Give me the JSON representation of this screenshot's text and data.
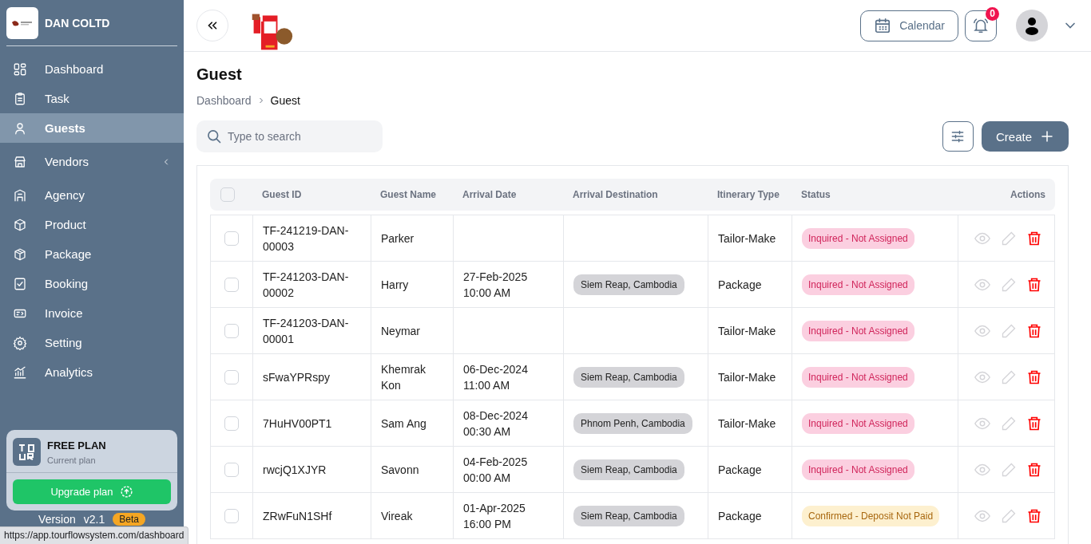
{
  "sidebar": {
    "brand": "DAN COLTD",
    "items": [
      {
        "label": "Dashboard",
        "selected": false
      },
      {
        "label": "Task",
        "selected": false
      },
      {
        "label": "Guests",
        "selected": true
      },
      {
        "label": "Vendors",
        "selected": false,
        "expandable": true
      },
      {
        "label": "Agency",
        "selected": false
      },
      {
        "label": "Product",
        "selected": false
      },
      {
        "label": "Package",
        "selected": false
      },
      {
        "label": "Booking",
        "selected": false
      },
      {
        "label": "Invoice",
        "selected": false
      },
      {
        "label": "Setting",
        "selected": false
      },
      {
        "label": "Analytics",
        "selected": false
      }
    ],
    "plan": {
      "title": "FREE PLAN",
      "subtitle": "Current plan",
      "button": "Upgrade plan"
    },
    "version": {
      "label": "Version",
      "number": "v2.1",
      "badge": "Beta"
    }
  },
  "topbar": {
    "calendar": "Calendar",
    "notifications": "0"
  },
  "page": {
    "title": "Guest",
    "breadcrumb": [
      "Dashboard",
      "Guest"
    ],
    "search_placeholder": "Type to search",
    "create": "Create"
  },
  "table": {
    "all_selected": false,
    "columns": [
      "Guest ID",
      "Guest Name",
      "Arrival Date",
      "Arrival Destination",
      "Itinerary Type",
      "Status",
      "Actions"
    ],
    "rows": [
      {
        "selected": false,
        "guest_id": "TF-241219-DAN-00003",
        "name": "Parker",
        "date": "",
        "time": "",
        "destination": "",
        "itinerary": "Tailor-Make",
        "status": {
          "text": "Inquired - Not Assigned",
          "kind": "inquired"
        }
      },
      {
        "selected": false,
        "guest_id": "TF-241203-DAN-00002",
        "name": "Harry",
        "date": "27-Feb-2025",
        "time": "10:00 AM",
        "destination": "Siem Reap, Cambodia",
        "itinerary": "Package",
        "status": {
          "text": "Inquired - Not Assigned",
          "kind": "inquired"
        }
      },
      {
        "selected": false,
        "guest_id": "TF-241203-DAN-00001",
        "name": "Neymar",
        "date": "",
        "time": "",
        "destination": "",
        "itinerary": "Tailor-Make",
        "status": {
          "text": "Inquired - Not Assigned",
          "kind": "inquired"
        }
      },
      {
        "selected": false,
        "guest_id": "sFwaYPRspy",
        "name": "Khemrak Kon",
        "date": "06-Dec-2024",
        "time": "11:00 AM",
        "destination": "Siem Reap, Cambodia",
        "itinerary": "Tailor-Make",
        "status": {
          "text": "Inquired - Not Assigned",
          "kind": "inquired"
        }
      },
      {
        "selected": false,
        "guest_id": "7HuHV00PT1",
        "name": "Sam Ang",
        "date": "08-Dec-2024",
        "time": "00:30 AM",
        "destination": "Phnom Penh, Cambodia",
        "itinerary": "Tailor-Make",
        "status": {
          "text": "Inquired - Not Assigned",
          "kind": "inquired"
        }
      },
      {
        "selected": false,
        "guest_id": "rwcjQ1XJYR",
        "name": "Savonn",
        "date": "04-Feb-2025",
        "time": "00:00 AM",
        "destination": "Siem Reap, Cambodia",
        "itinerary": "Package",
        "status": {
          "text": "Inquired - Not Assigned",
          "kind": "inquired"
        }
      },
      {
        "selected": false,
        "guest_id": "ZRwFuN1SHf",
        "name": "Vireak",
        "date": "01-Apr-2025",
        "time": "16:00 PM",
        "destination": "Siem Reap, Cambodia",
        "itinerary": "Package",
        "status": {
          "text": "Confirmed - Deposit Not Paid",
          "kind": "confirmed"
        }
      }
    ]
  },
  "status_bar": "https://app.tourflowsystem.com/dashboard"
}
